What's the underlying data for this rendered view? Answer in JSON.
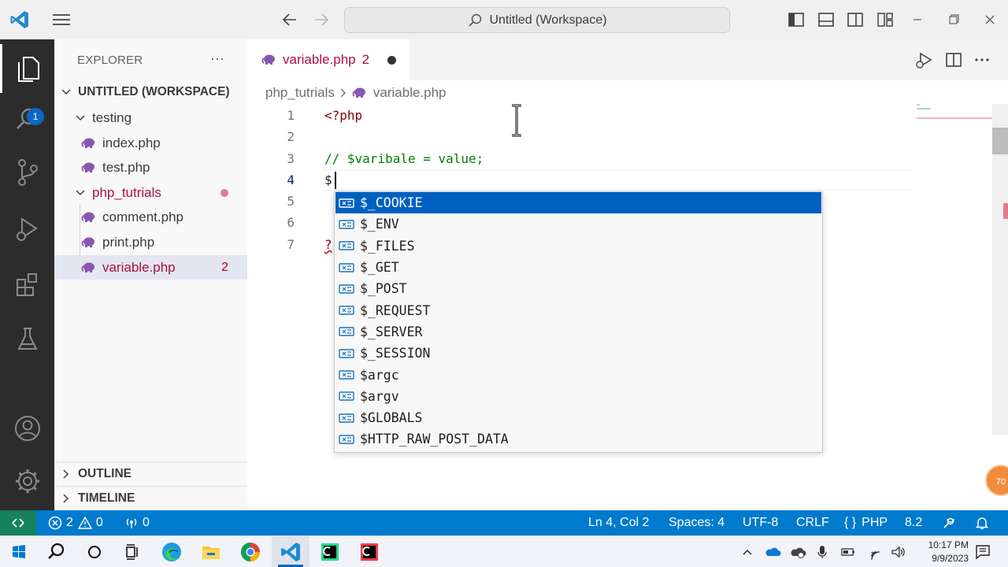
{
  "titlebar": {
    "search_text": "Untitled (Workspace)"
  },
  "activitybar": {
    "explorer_badge": "1"
  },
  "sidebar": {
    "title": "EXPLORER",
    "more": "···",
    "workspace": "UNTITLED (WORKSPACE)",
    "folders": [
      {
        "name": "testing",
        "files": [
          "index.php",
          "test.php"
        ]
      },
      {
        "name": "php_tutrials",
        "files": [
          "comment.php",
          "print.php",
          "variable.php"
        ]
      }
    ],
    "active_file_problems": "2",
    "outline": "OUTLINE",
    "timeline": "TIMELINE"
  },
  "editor": {
    "tab_label": "variable.php",
    "tab_problems": "2",
    "breadcrumb_folder": "php_tutrials",
    "breadcrumb_file": "variable.php",
    "line_numbers": [
      "1",
      "2",
      "3",
      "4",
      "5",
      "6",
      "7"
    ],
    "lines": {
      "l1": "<?php",
      "l3": "// $varibale = value;",
      "l4": "$",
      "l7": "?"
    }
  },
  "suggestions": [
    "$_COOKIE",
    "$_ENV",
    "$_FILES",
    "$_GET",
    "$_POST",
    "$_REQUEST",
    "$_SERVER",
    "$_SESSION",
    "$argc",
    "$argv",
    "$GLOBALS",
    "$HTTP_RAW_POST_DATA"
  ],
  "overlay": {
    "zoom_bubble": "70"
  },
  "statusbar": {
    "errors": "2",
    "warnings": "0",
    "ports": "0",
    "position": "Ln 4, Col 2",
    "spaces": "Spaces: 4",
    "encoding": "UTF-8",
    "eol": "CRLF",
    "language": "PHP",
    "version": "8.2"
  },
  "taskbar": {
    "time": "10:17 PM",
    "date": "9/9/2023"
  },
  "colors": {
    "accent": "#007acc",
    "selection": "#0060c0",
    "error_text": "#ad0f3e",
    "remote": "#16825d"
  }
}
